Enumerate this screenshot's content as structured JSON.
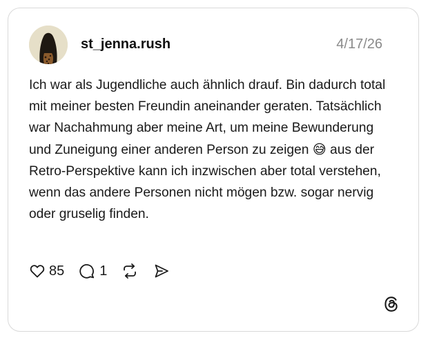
{
  "post": {
    "username": "st_jenna.rush",
    "date": "4/17/26",
    "text": "Ich war als Jugendliche auch ähnlich drauf. Bin dadurch total mit meiner besten Freundin aneinander geraten. Tatsächlich war Nachahmung aber meine Art, um meine Bewunderung und Zuneigung einer anderen Person zu zeigen 😅 aus der Retro-Perspektive kann ich inzwischen aber total verstehen, wenn das andere Personen nicht mögen bzw. sogar nervig oder gruselig finden."
  },
  "actions": {
    "like_count": "85",
    "reply_count": "1"
  },
  "icons": {
    "like": "heart-icon",
    "reply": "speech-bubble-icon",
    "repost": "repost-icon",
    "share": "send-icon",
    "brand": "threads-logo-icon"
  },
  "colors": {
    "text": "#1a1a1a",
    "date": "#8a8a8a",
    "border": "#d9d9d9"
  }
}
